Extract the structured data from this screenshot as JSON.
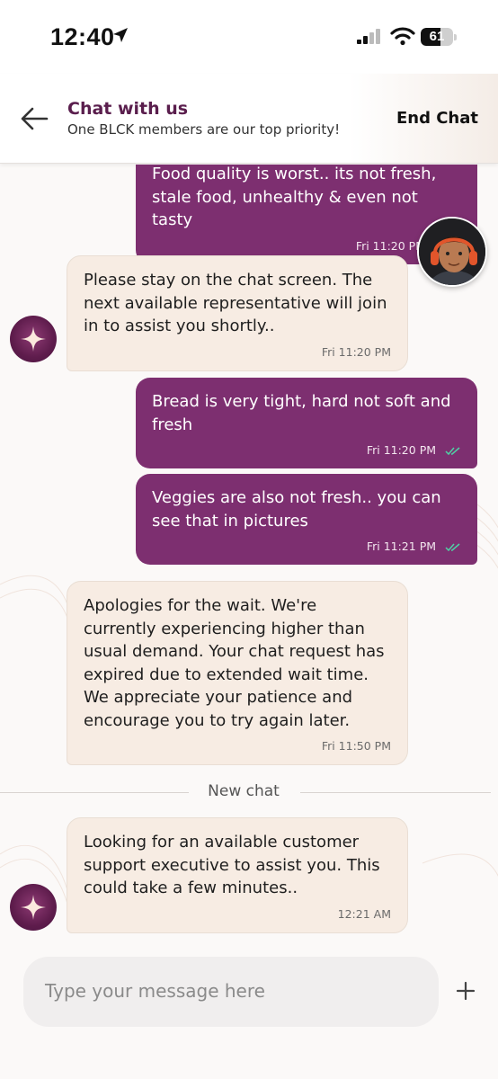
{
  "status_bar": {
    "time": "12:40",
    "battery_level": "61",
    "icons": [
      "location-arrow-icon",
      "cellular-signal-icon",
      "wifi-icon",
      "battery-icon"
    ]
  },
  "header": {
    "back_icon": "arrow-left-icon",
    "title": "Chat with us",
    "subtitle": "One BLCK members are our top priority!",
    "end_chat_label": "End Chat"
  },
  "messages": [
    {
      "direction": "outgoing",
      "text": "Food quality is worst.. its not fresh, stale food, unhealthy & even not tasty",
      "time": "Fri 11:20 PM"
    },
    {
      "direction": "incoming",
      "text": "Please stay on the chat screen. The next available representative will join in to assist you shortly..",
      "time": "Fri 11:20 PM"
    },
    {
      "direction": "outgoing",
      "text": "Bread is very tight, hard not soft and fresh",
      "time": "Fri 11:20 PM"
    },
    {
      "direction": "outgoing",
      "text": "Veggies are also not fresh.. you can see that in pictures",
      "time": "Fri 11:21 PM"
    },
    {
      "direction": "incoming",
      "text": "Apologies for the wait. We're currently experiencing higher than usual demand. Your chat request has expired due to extended wait time. We appreciate your patience and encourage you to try again later.",
      "time": "Fri 11:50 PM"
    },
    {
      "direction": "incoming",
      "text": "Looking for an available customer support executive to assist you. This could take a few minutes..",
      "time": "12:21 AM"
    }
  ],
  "divider_label": "New chat",
  "composer": {
    "placeholder": "Type your message here",
    "plus_icon": "plus-icon"
  },
  "colors": {
    "outgoing_bubble": "#7d2f70",
    "incoming_bubble": "#f7ece3",
    "header_title": "#5a1e4d",
    "read_ticks": "#4fd1a5"
  }
}
